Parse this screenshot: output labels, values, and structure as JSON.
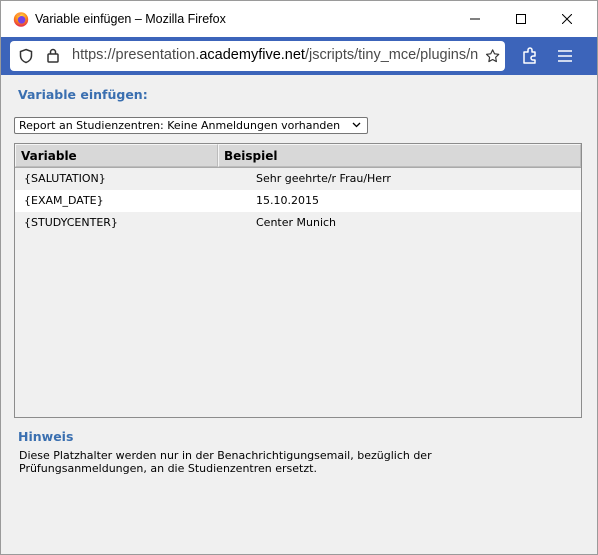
{
  "window": {
    "title": "Variable einfügen – Mozilla Firefox"
  },
  "urlbar": {
    "url_prefix": "https://presentation.",
    "url_host": "academyfive.net",
    "url_path": "/jscripts/tiny_mce/plugins/nev"
  },
  "colors": {
    "toolbar": "#3c64ba",
    "heading": "#3a6fb0"
  },
  "page": {
    "heading": "Variable einfügen:",
    "select_value": "Report an Studienzentren: Keine Anmeldungen vorhanden",
    "table": {
      "columns": [
        "Variable",
        "Beispiel"
      ],
      "rows": [
        {
          "variable": "{SALUTATION}",
          "example": "Sehr geehrte/r Frau/Herr"
        },
        {
          "variable": "{EXAM_DATE}",
          "example": "15.10.2015"
        },
        {
          "variable": "{STUDYCENTER}",
          "example": "Center Munich"
        }
      ]
    },
    "hint_title": "Hinweis",
    "hint_text": "Diese Platzhalter werden nur in der Benachrichtigungsemail, bezüglich der Prüfungsanmeldungen, an die Studienzentren ersetzt."
  }
}
